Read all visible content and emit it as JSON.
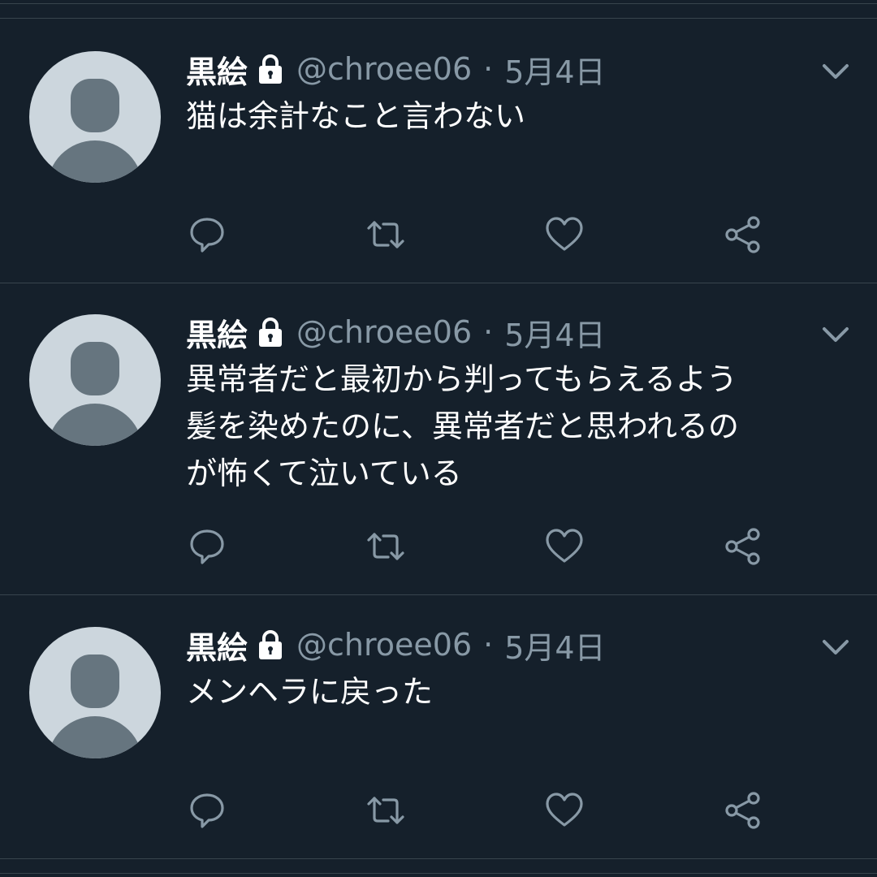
{
  "colors": {
    "background": "#15202b",
    "divider": "#38444d",
    "primary_text": "#ffffff",
    "secondary_text": "#8899a6",
    "avatar_bg": "#ccd6dd",
    "avatar_fg": "#66757f"
  },
  "tweets": [
    {
      "display_name": "黒絵",
      "handle": "@chroee06",
      "separator": "·",
      "date": "5月4日",
      "text": "猫は余計なこと言わない",
      "locked": true
    },
    {
      "display_name": "黒絵",
      "handle": "@chroee06",
      "separator": "·",
      "date": "5月4日",
      "text": "異常者だと最初から判ってもらえるよう\n髪を染めたのに、異常者だと思われるの\nが怖くて泣いている",
      "locked": true
    },
    {
      "display_name": "黒絵",
      "handle": "@chroee06",
      "separator": "·",
      "date": "5月4日",
      "text": "メンヘラに戻った",
      "locked": true
    }
  ],
  "icons": [
    "reply-icon",
    "retweet-icon",
    "like-icon",
    "share-icon",
    "lock-icon",
    "chevron-down-icon"
  ]
}
